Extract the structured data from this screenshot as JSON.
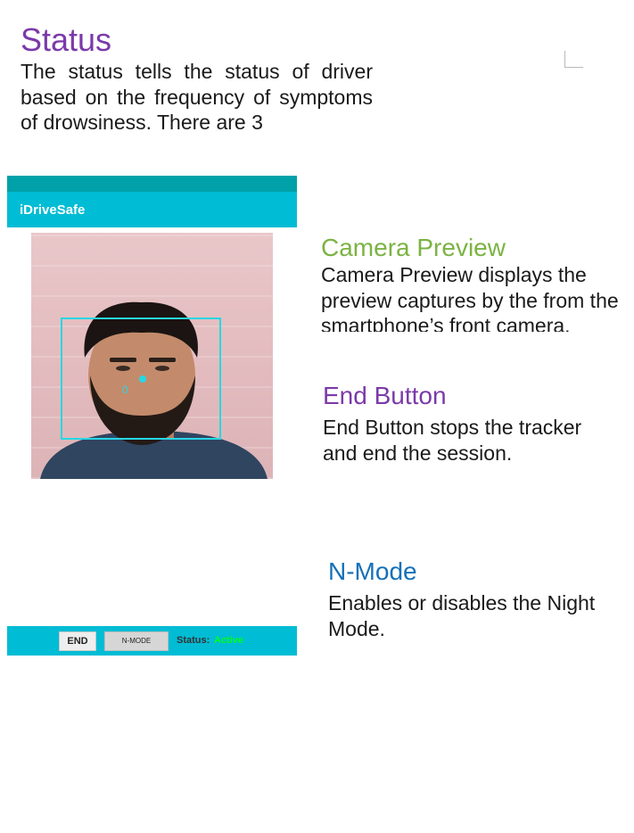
{
  "status_section": {
    "title": "Status",
    "text": "The status tells the status of driver based on the frequency of symptoms of drowsiness. There are 3"
  },
  "app": {
    "title": "iDriveSafe",
    "colors": {
      "statusbar": "#00a1a8",
      "toolbar": "#00bcd4",
      "overlay": "#27d7e4",
      "active": "#00ff1a"
    },
    "camera": {
      "face_label": "0"
    },
    "bottom_bar": {
      "end_label": "END",
      "nmode_label": "N-MODE",
      "status_label": "Status:",
      "status_value": "Active"
    }
  },
  "annotations": {
    "camera_preview": {
      "title": "Camera Preview",
      "text": "Camera Preview displays the preview captures by the from the smartphone’s front camera."
    },
    "end_button": {
      "title": "End Button",
      "text": "End Button stops the tracker and end the session."
    },
    "n_mode": {
      "title": "N-Mode",
      "text": "Enables or disables the Night Mode."
    }
  }
}
